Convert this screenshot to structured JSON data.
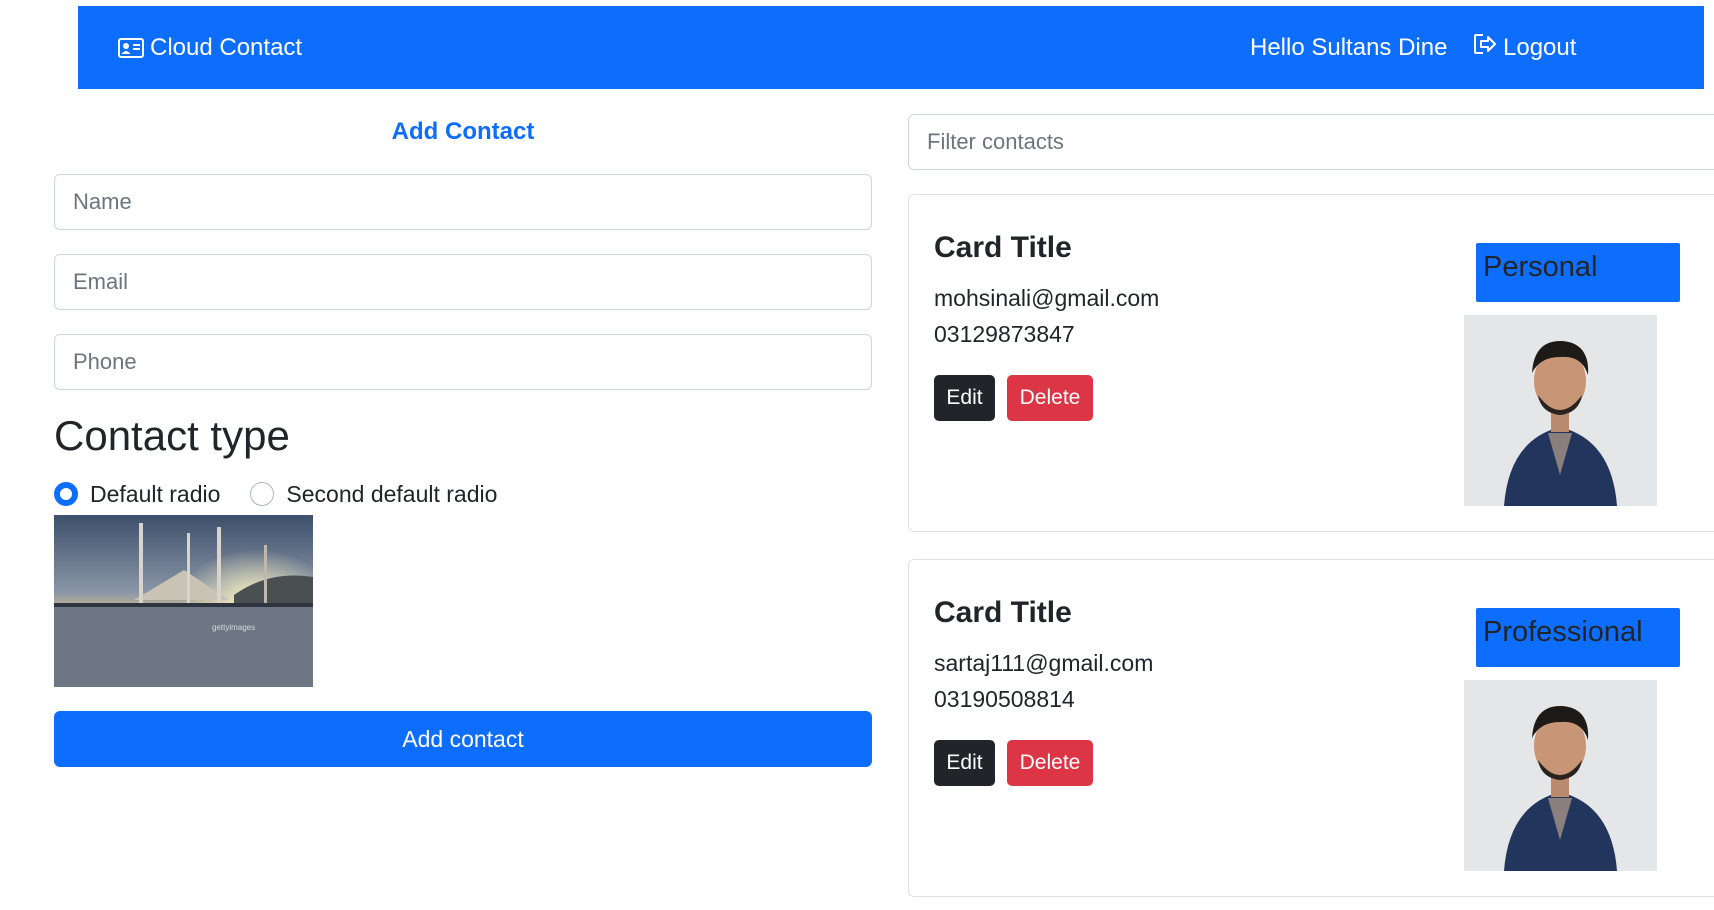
{
  "navbar": {
    "brand": "Cloud Contact",
    "brand_icon": "contact-card-icon",
    "greeting": "Hello Sultans Dine",
    "logout_label": "Logout",
    "logout_icon": "logout-icon",
    "bg_color": "#0d6efd"
  },
  "form": {
    "title": "Add Contact",
    "name_placeholder": "Name",
    "email_placeholder": "Email",
    "phone_placeholder": "Phone",
    "contact_type_heading": "Contact type",
    "radio_options": [
      {
        "label": "Default radio",
        "checked": true
      },
      {
        "label": "Second default radio",
        "checked": false
      }
    ],
    "submit_label": "Add contact"
  },
  "filter": {
    "placeholder": "Filter contacts"
  },
  "contacts": [
    {
      "title": "Card Title",
      "email": "mohsinali@gmail.com",
      "phone": "03129873847",
      "type": "Personal",
      "edit_label": "Edit",
      "delete_label": "Delete"
    },
    {
      "title": "Card Title",
      "email": "sartaj111@gmail.com",
      "phone": "03190508814",
      "type": "Professional",
      "edit_label": "Edit",
      "delete_label": "Delete"
    }
  ],
  "colors": {
    "primary": "#0d6efd",
    "danger": "#dc3545",
    "dark": "#212529"
  }
}
